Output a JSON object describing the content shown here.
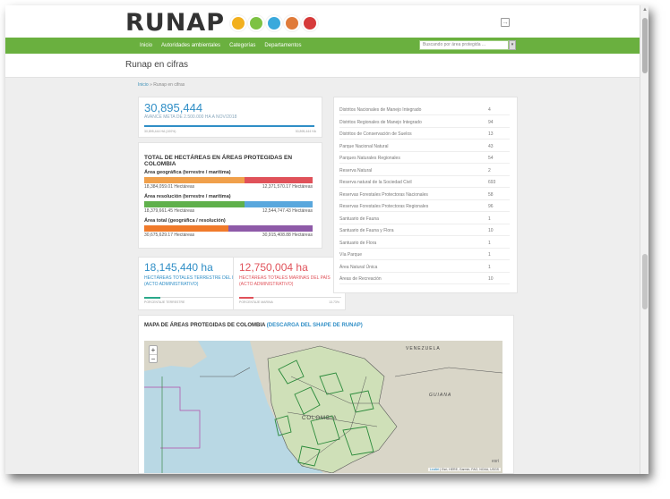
{
  "app": {
    "logo_text": "RUNAP",
    "logo_colors": [
      "#f2b01e",
      "#7dc243",
      "#3aa9dc",
      "#e07b3a",
      "#d63a3a"
    ]
  },
  "nav": {
    "items": [
      "Inicio",
      "Autoridades ambientales",
      "Categorías",
      "Departamentos"
    ],
    "search_placeholder": "Buscando por área protegida ...",
    "search_button": "▾"
  },
  "page": {
    "title": "Runap en cifras",
    "breadcrumb": {
      "home": "Inicio",
      "sep": "»",
      "current": "Runap en cifras"
    }
  },
  "goal": {
    "value": "30,895,444",
    "label": "AVANCE META DE 2.500.000 HA A NOV/2018",
    "progress": 1.0,
    "min_text": "30,895,444 HA (100%)",
    "max_text": "30,895,444 HA"
  },
  "totals": {
    "title": "TOTAL DE HECTÁREAS EN ÁREAS PROTEGIDAS EN COLOMBIA",
    "bars": [
      {
        "label": "Área geográfica (terrestre / marítima)",
        "left_value": "18,384,059.01 Hectáreas",
        "right_value": "12,371,570.17 Hectáreas",
        "left_fraction": 0.598,
        "left_color": "#f0a04b",
        "right_color": "#e0525a"
      },
      {
        "label": "Área resolución (terrestre / marítima)",
        "left_value": "18,379,661.45 Hectáreas",
        "right_value": "12,544,747.43 Hectáreas",
        "left_fraction": 0.594,
        "left_color": "#5fb04b",
        "right_color": "#59a7dd"
      },
      {
        "label": "Área total (geográfica / resolución)",
        "left_value": "30,675,629.17 Hectáreas",
        "right_value": "30,915,408.88 Hectáreas",
        "left_fraction": 0.498,
        "left_color": "#f07a2a",
        "right_color": "#8e5aa8"
      }
    ]
  },
  "stat_terrestre": {
    "value": "18,145,440 ha",
    "label": "HECTÁREAS TOTALES TERRESTRE DEL PAÍS (ACTO ADMINISTRATIVO)",
    "foot": "PORCENTAJE TERRESTRE",
    "pct": "15.89 %",
    "fraction": 0.1589,
    "color": "#2f8ec6",
    "bar_color": "#2aa88a"
  },
  "stat_marinas": {
    "value": "12,750,004 ha",
    "label": "HECTÁREAS TOTALES MARINAS DEL PAÍS (ACTO ADMINISTRATIVO)",
    "foot": "PORCENTAJE MARINA",
    "pct": "13.73%",
    "fraction": 0.1373,
    "color": "#e0525a",
    "bar_color": "#e0525a"
  },
  "categories": [
    {
      "name": "Distritos Nacionales de Manejo Integrado",
      "count": "4"
    },
    {
      "name": "Distritos Regionales de Manejo Integrado",
      "count": "94"
    },
    {
      "name": "Distritos de Conservación de Suelos",
      "count": "13"
    },
    {
      "name": "Parque Nacional Natural",
      "count": "43"
    },
    {
      "name": "Parques Naturales Regionales",
      "count": "54"
    },
    {
      "name": "Reserva Natural",
      "count": "2"
    },
    {
      "name": "Reserva natural de la Sociedad Civil",
      "count": "693"
    },
    {
      "name": "Reservas Forestales Protectoras Nacionales",
      "count": "58"
    },
    {
      "name": "Reservas Forestales Protectoras Regionales",
      "count": "96"
    },
    {
      "name": "Santuario de Fauna",
      "count": "1"
    },
    {
      "name": "Santuario de Fauna y Flora",
      "count": "10"
    },
    {
      "name": "Santuario de Flora",
      "count": "1"
    },
    {
      "name": "Vía Parque",
      "count": "1"
    },
    {
      "name": "Área Natural Única",
      "count": "1"
    },
    {
      "name": "Áreas de Recreación",
      "count": "10"
    }
  ],
  "map": {
    "title": "MAPA DE ÁREAS PROTEGIDAS DE COLOMBIA",
    "link": "(DESCARGA DEL SHAPE DE RUNAP)",
    "zoom_in": "+",
    "zoom_out": "−",
    "labels": [
      "VENEZUELA",
      "COLOMBIA",
      "GUIANA"
    ],
    "attrib_leaflet": "Leaflet",
    "attrib_rest": "| Esri, HERE, Garmin, FAO, NOAA, USGS",
    "esri_logo": "esri"
  }
}
